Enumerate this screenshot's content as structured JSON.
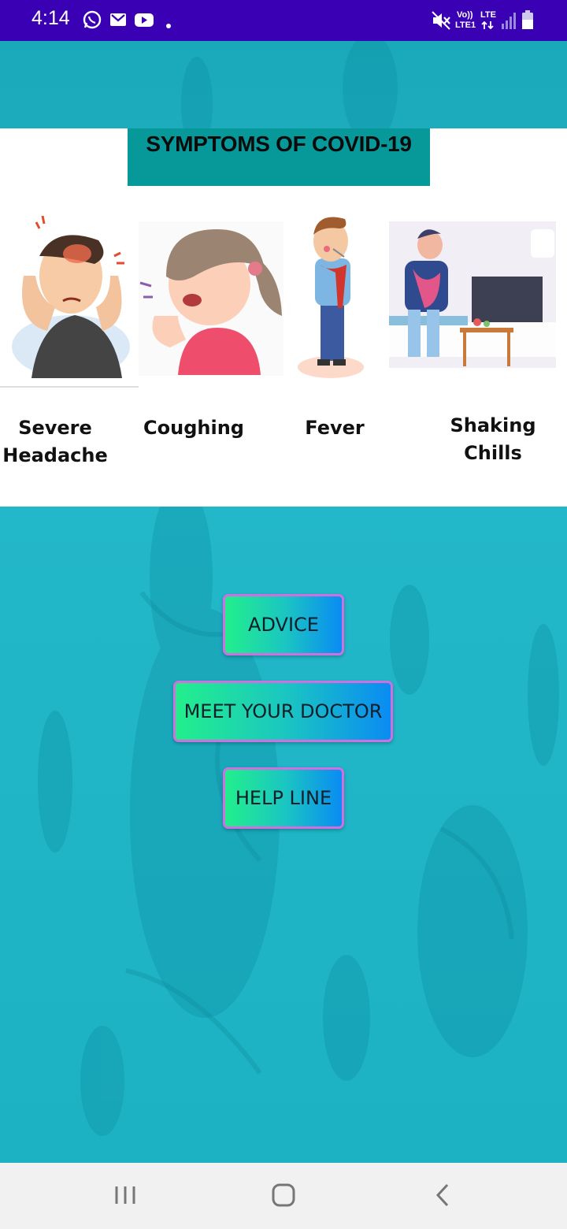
{
  "status_bar": {
    "time": "4:14",
    "left_icons": [
      "whatsapp-icon",
      "gmail-icon",
      "youtube-icon",
      "dot-icon"
    ],
    "right_icons": [
      "mute-icon",
      "volte-lte-icon",
      "signal-icon",
      "battery-icon"
    ],
    "volte_label": "Vo))",
    "lte1_label": "LTE1",
    "lte_label": "LTE"
  },
  "symptoms": {
    "title": "SYMPTOMS OF COVID-19",
    "items": [
      {
        "line1": "Severe",
        "line2": "Headache",
        "icon": "headache-illustration"
      },
      {
        "line1": "Coughing",
        "line2": "",
        "icon": "coughing-illustration"
      },
      {
        "line1": "Fever",
        "line2": "",
        "icon": "fever-illustration"
      },
      {
        "line1": "Shaking",
        "line2": "Chills",
        "icon": "chills-illustration"
      }
    ]
  },
  "buttons": {
    "advice": "ADVICE",
    "meet_doctor": "MEET YOUR DOCTOR",
    "help_line": "HELP LINE"
  },
  "nav": {
    "recents": "recents-icon",
    "home": "home-icon",
    "back": "back-icon"
  },
  "colors": {
    "status_bar": "#3a00b4",
    "title_bg": "#07999a",
    "background": "#1fb3c4",
    "button_border": "#d06fe0"
  }
}
